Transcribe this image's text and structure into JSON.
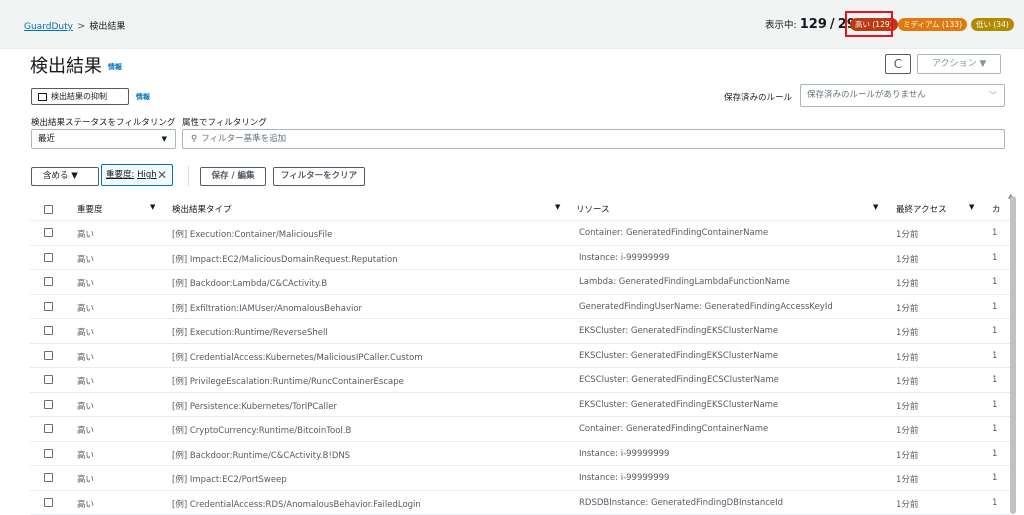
{
  "breadcrumb": {
    "service": "GuardDuty",
    "separator": ">",
    "current": "検出結果"
  },
  "counts": {
    "showing_label": "表示中:",
    "showing": "129",
    "slash": "/",
    "total": "296",
    "high": "高い (129)",
    "medium": "ミディアム (133)",
    "low": "低い (34)"
  },
  "colors": {
    "high": "#b83b16",
    "medium": "#e0790e",
    "low": "#b08b00",
    "link": "#0073bb",
    "highlight": "#e6111a"
  },
  "page": {
    "title": "検出結果",
    "info": "情報"
  },
  "toolbar": {
    "refresh_icon": "C",
    "actions": "アクション ▼"
  },
  "suppress": {
    "label": "検出結果の抑制",
    "info": "情報"
  },
  "saved_rules": {
    "label": "保存済みのルール",
    "placeholder": "保存済みのルールがありません"
  },
  "filters": {
    "status_label": "検出結果ステータスをフィルタリング",
    "attr_label": "属性でフィルタリング",
    "status_value": "最近",
    "search_placeholder": "フィルター基準を追加"
  },
  "chips": {
    "include": "含める ▼",
    "token_key": "重要度:",
    "token_value": "High",
    "save_edit": "保存 / 編集",
    "clear": "フィルターをクリア"
  },
  "table": {
    "headers": {
      "severity": "重要度",
      "type": "検出結果タイプ",
      "resource": "リソース",
      "last_seen": "最終アクセス",
      "count": "カ"
    },
    "rows": [
      {
        "severity": "高い",
        "type": "[例] Execution:Container/MaliciousFile",
        "resource": "Container: GeneratedFindingContainerName",
        "last_seen": "1分前",
        "count": "1"
      },
      {
        "severity": "高い",
        "type": "[例] Impact:EC2/MaliciousDomainRequest.Reputation",
        "resource": "Instance: i-99999999",
        "last_seen": "1分前",
        "count": "1"
      },
      {
        "severity": "高い",
        "type": "[例] Backdoor:Lambda/C&CActivity.B",
        "resource": "Lambda: GeneratedFindingLambdaFunctionName",
        "last_seen": "1分前",
        "count": "1"
      },
      {
        "severity": "高い",
        "type": "[例] Exfiltration:IAMUser/AnomalousBehavior",
        "resource": "GeneratedFindingUserName: GeneratedFindingAccessKeyId",
        "last_seen": "1分前",
        "count": "1"
      },
      {
        "severity": "高い",
        "type": "[例] Execution:Runtime/ReverseShell",
        "resource": "EKSCluster: GeneratedFindingEKSClusterName",
        "last_seen": "1分前",
        "count": "1"
      },
      {
        "severity": "高い",
        "type": "[例] CredentialAccess:Kubernetes/MaliciousIPCaller.Custom",
        "resource": "EKSCluster: GeneratedFindingEKSClusterName",
        "last_seen": "1分前",
        "count": "1"
      },
      {
        "severity": "高い",
        "type": "[例] PrivilegeEscalation:Runtime/RuncContainerEscape",
        "resource": "ECSCluster: GeneratedFindingECSClusterName",
        "last_seen": "1分前",
        "count": "1"
      },
      {
        "severity": "高い",
        "type": "[例] Persistence:Kubernetes/TorIPCaller",
        "resource": "EKSCluster: GeneratedFindingEKSClusterName",
        "last_seen": "1分前",
        "count": "1"
      },
      {
        "severity": "高い",
        "type": "[例] CryptoCurrency:Runtime/BitcoinTool.B",
        "resource": "Container: GeneratedFindingContainerName",
        "last_seen": "1分前",
        "count": "1"
      },
      {
        "severity": "高い",
        "type": "[例] Backdoor:Runtime/C&CActivity.B!DNS",
        "resource": "Instance: i-99999999",
        "last_seen": "1分前",
        "count": "1"
      },
      {
        "severity": "高い",
        "type": "[例] Impact:EC2/PortSweep",
        "resource": "Instance: i-99999999",
        "last_seen": "1分前",
        "count": "1"
      },
      {
        "severity": "高い",
        "type": "[例] CredentialAccess:RDS/AnomalousBehavior.FailedLogin",
        "resource": "RDSDBInstance: GeneratedFindingDBInstanceId",
        "last_seen": "1分前",
        "count": "1"
      }
    ]
  }
}
